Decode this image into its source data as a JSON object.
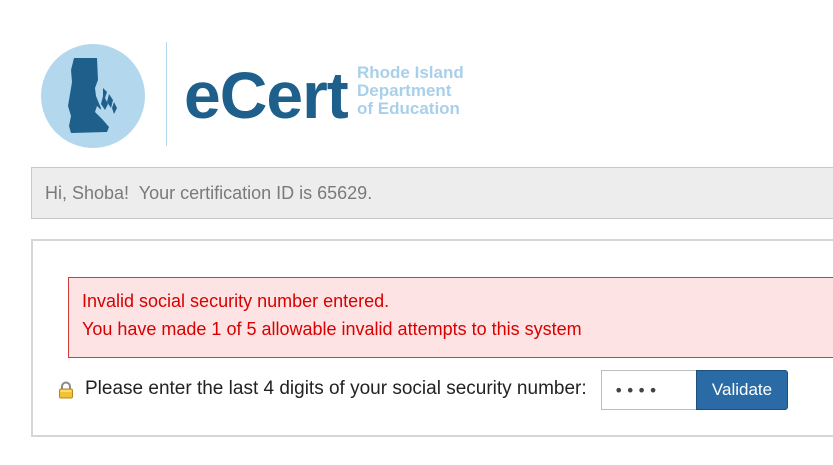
{
  "logo": {
    "wordmark": "eCert",
    "line1": "Rhode Island",
    "line2": "Department",
    "line3": "of Education"
  },
  "greeting": "Hi, Shoba!  Your certification ID is 65629.",
  "alert": {
    "line1": "Invalid social security number entered.",
    "line2": "You have made 1 of 5 allowable invalid attempts to this system"
  },
  "form": {
    "prompt": "Please enter the last 4 digits of your social security number:",
    "ssn_value": "••••",
    "validate_label": "Validate"
  },
  "colors": {
    "brand": "#1f5f8b",
    "brand_light": "#b3d8ee",
    "alert_text": "#d80000",
    "alert_bg": "#fde3e3",
    "button": "#2a6aa5"
  }
}
